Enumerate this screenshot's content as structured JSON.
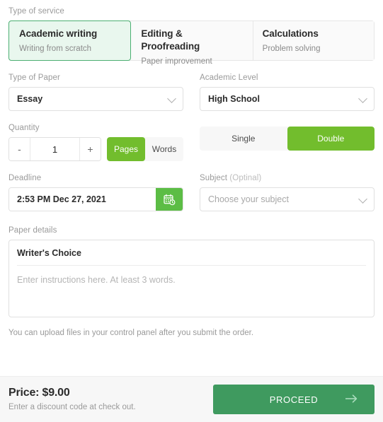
{
  "service": {
    "label": "Type of service",
    "tabs": [
      {
        "title": "Academic writing",
        "subtitle": "Writing from scratch",
        "selected": true
      },
      {
        "title": "Editing & Proofreading",
        "subtitle": "Paper improvement",
        "selected": false
      },
      {
        "title": "Calculations",
        "subtitle": "Problem solving",
        "selected": false
      }
    ]
  },
  "paper_type": {
    "label": "Type of Paper",
    "value": "Essay",
    "chevron_icon": "chevron-down-icon"
  },
  "academic_level": {
    "label": "Academic Level",
    "value": "High School",
    "chevron_icon": "chevron-down-icon"
  },
  "quantity": {
    "label": "Quantity",
    "decrement_label": "-",
    "value": "1",
    "increment_label": "+",
    "units": [
      {
        "label": "Pages",
        "active": true
      },
      {
        "label": "Words",
        "active": false
      }
    ]
  },
  "spacing": {
    "options": [
      {
        "label": "Single",
        "active": false
      },
      {
        "label": "Double",
        "active": true
      }
    ]
  },
  "deadline": {
    "label": "Deadline",
    "value": "2:53 PM Dec 27, 2021",
    "calendar_icon": "calendar-clock-icon"
  },
  "subject": {
    "label": "Subject",
    "optional_note": "(Optinal)",
    "placeholder": "Choose your subject",
    "chevron_icon": "chevron-down-icon"
  },
  "paper_details": {
    "label": "Paper details",
    "topic_value": "Writer's Choice",
    "instructions_placeholder": "Enter instructions here. At least 3 words.",
    "upload_note": "You can upload files in your control panel after you submit the order."
  },
  "footer": {
    "price_text": "Price: $9.00",
    "discount_text": "Enter a discount code at check out.",
    "proceed_label": "PROCEED",
    "arrow_icon": "arrow-right-icon"
  },
  "colors": {
    "accent_green": "#72bd2d",
    "calendar_green": "#5cbd45",
    "proceed_green": "#3f9a5f",
    "selected_tab_bg": "#e9f7ee",
    "selected_tab_border": "#4caf72"
  }
}
